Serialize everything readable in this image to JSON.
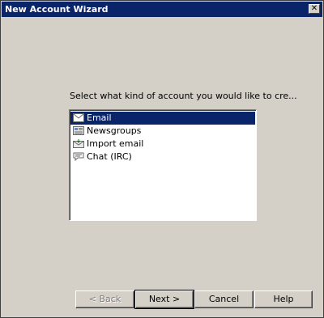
{
  "window": {
    "title": "New Account Wizard"
  },
  "prompt": "Select what kind of account you would like to cre...",
  "account_types": [
    {
      "label": "Email",
      "icon": "envelope-icon",
      "selected": true
    },
    {
      "label": "Newsgroups",
      "icon": "newsgroup-icon",
      "selected": false
    },
    {
      "label": "Import email",
      "icon": "import-icon",
      "selected": false
    },
    {
      "label": "Chat (IRC)",
      "icon": "chat-icon",
      "selected": false
    }
  ],
  "buttons": {
    "back": "< Back",
    "next": "Next >",
    "cancel": "Cancel",
    "help": "Help"
  },
  "colors": {
    "titlebar": "#0a246a",
    "selection": "#0a246a",
    "face": "#d4d0c8"
  }
}
